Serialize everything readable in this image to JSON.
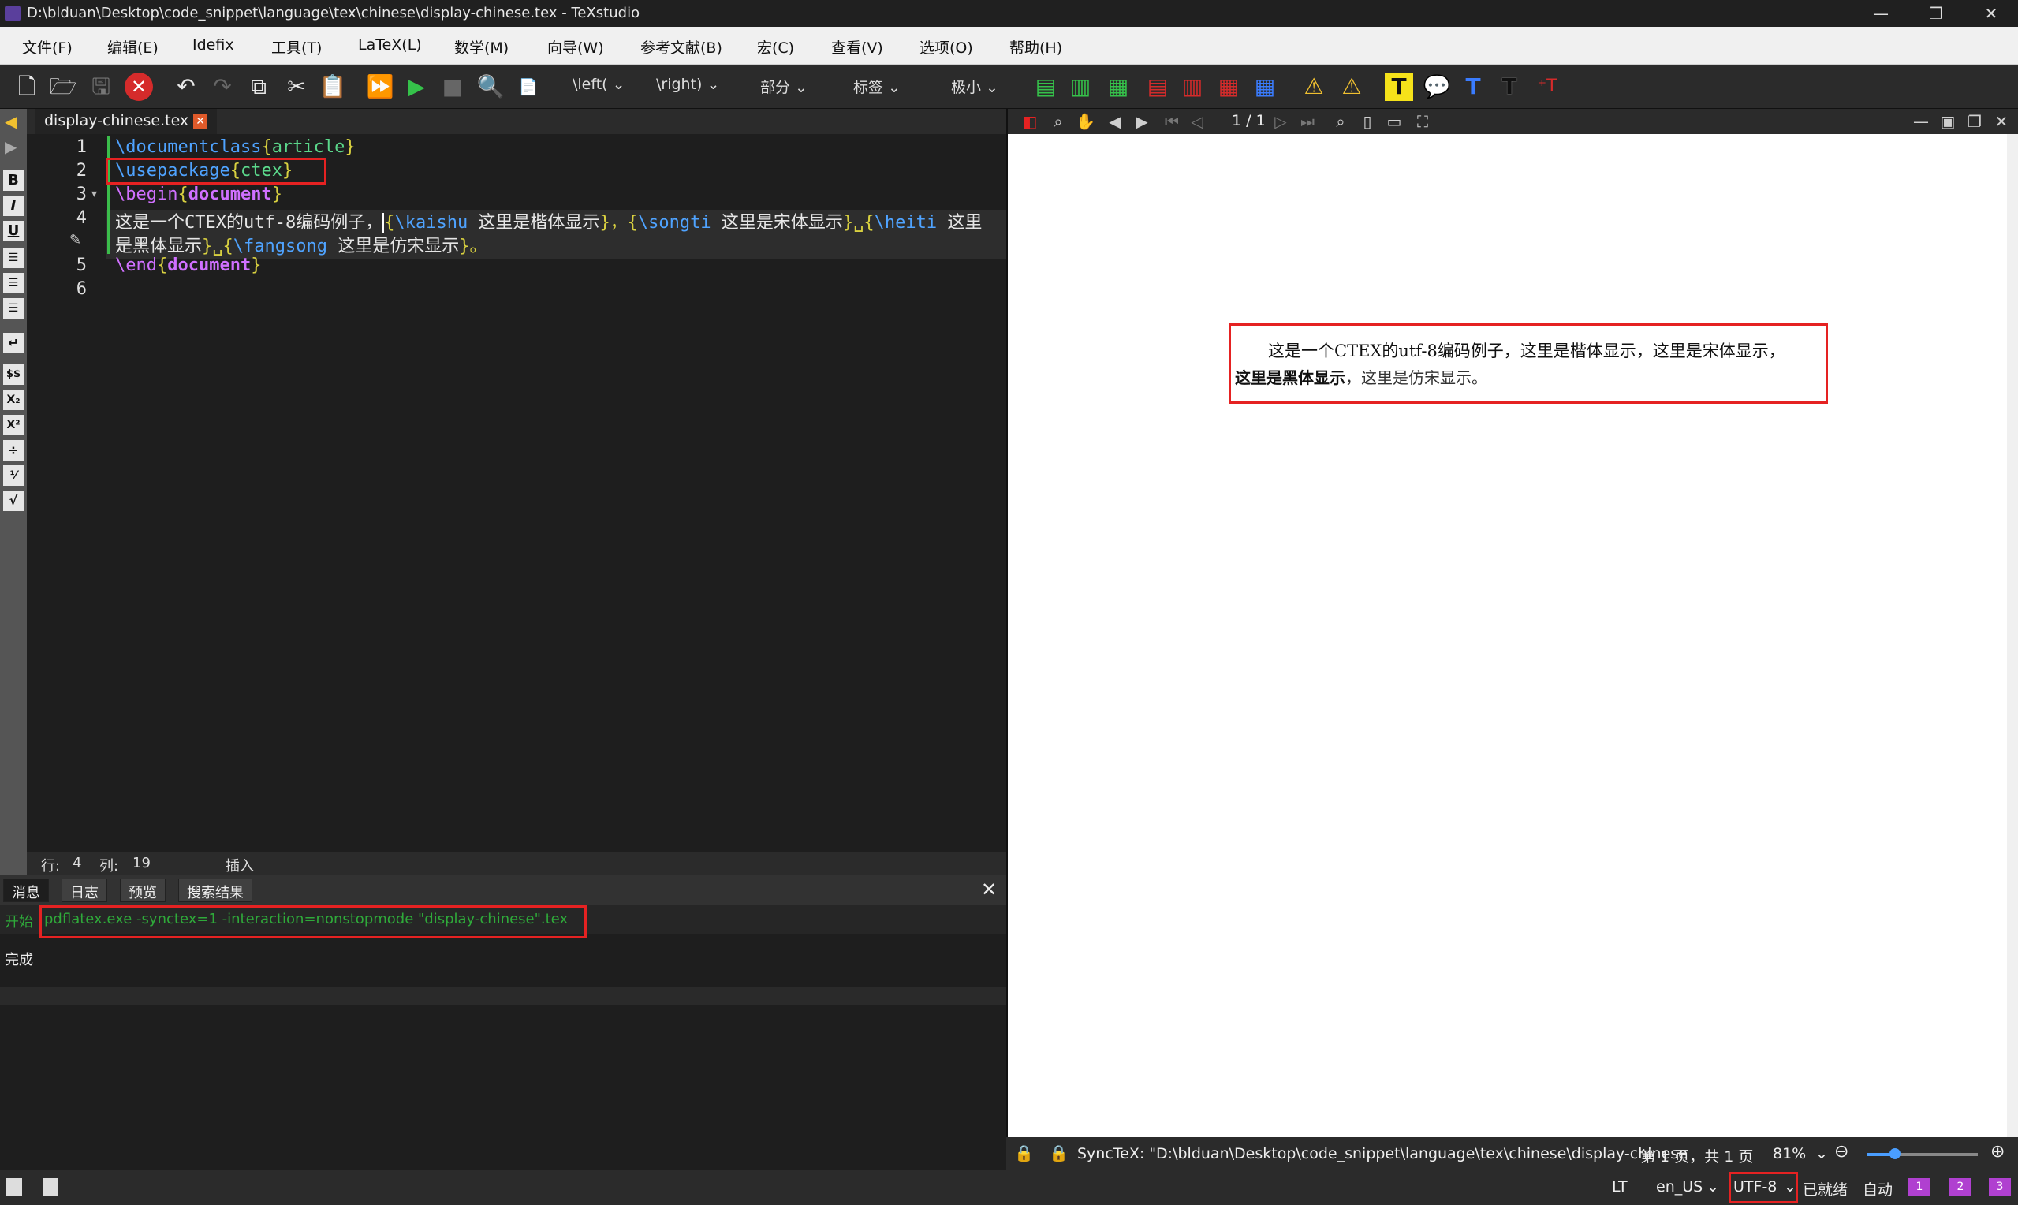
{
  "window": {
    "title": "D:\\blduan\\Desktop\\code_snippet\\language\\tex\\chinese\\display-chinese.tex - TeXstudio",
    "minimize": "—",
    "maximize": "❐",
    "close": "✕"
  },
  "menu": [
    "文件(F)",
    "编辑(E)",
    "Idefix",
    "工具(T)",
    "LaTeX(L)",
    "数学(M)",
    "向导(W)",
    "参考文献(B)",
    "宏(C)",
    "查看(V)",
    "选项(O)",
    "帮助(H)"
  ],
  "toolbar": {
    "left_delim": "\\left(",
    "right_delim": "\\right)",
    "section": "部分",
    "label": "标签",
    "size": "极小"
  },
  "editor": {
    "tab_label": "display-chinese.tex",
    "line_numbers": [
      "1",
      "2",
      "3",
      "4",
      "5",
      "6"
    ],
    "lines": {
      "l1_cmd": "\\documentclass",
      "l1_open": "{",
      "l1_arg": "article",
      "l1_close": "}",
      "l2_cmd": "\\usepackage",
      "l2_open": "{",
      "l2_arg": "ctex",
      "l2_close": "}",
      "l3_cmd": "\\begin",
      "l3_open": "{",
      "l3_arg": "document",
      "l3_close": "}",
      "l4_a": "这是一个CTEX的utf-8编码例子，",
      "l4_b": "{",
      "l4_c": "\\kaishu",
      "l4_d": " 这里是楷体显示",
      "l4_e": "}，{",
      "l4_f": "\\songti",
      "l4_g": " 这里是宋体显示",
      "l4_h": "}␣{",
      "l4_i": "\\heiti",
      "l4_j": " 这里",
      "l4b_a": "是黑体显示",
      "l4b_b": "}␣{",
      "l4b_c": "\\fangsong",
      "l4b_d": " 这里是仿宋显示",
      "l4b_e": "}。",
      "l5_cmd": "\\end",
      "l5_open": "{",
      "l5_arg": "document",
      "l5_close": "}"
    },
    "status": {
      "row_label": "行:",
      "row": "4",
      "col_label": "列:",
      "col": "19",
      "mode": "插入"
    }
  },
  "bottom_panel": {
    "tabs": [
      "消息",
      "日志",
      "预览",
      "搜索结果"
    ],
    "start_label": "开始",
    "command": "pdflatex.exe -synctex=1 -interaction=nonstopmode \"display-chinese\".tex",
    "done": "完成"
  },
  "viewer": {
    "page_indicator": "1 / 1",
    "pdf_line1": "这是一个CTEX的utf-8编码例子，这里是楷体显示，这里是宋体显示，",
    "pdf_line2_bold": "这里是黑体显示",
    "pdf_line2_rest": "，这里是仿宋显示。",
    "synctex": "SyncTeX: \"D:\\blduan\\Desktop\\code_snippet\\language\\tex\\chinese\\display-chinese",
    "page_info": "第 1 页，共 1 页",
    "zoom": "81%",
    "zoom_fraction": 0.25
  },
  "statusbar": {
    "lt": "LT",
    "language": "en_US",
    "encoding": "UTF-8",
    "ready": "已就绪",
    "auto": "自动"
  },
  "colors": {
    "highlight_red": "#e52222",
    "accent_green": "#35c24a"
  }
}
